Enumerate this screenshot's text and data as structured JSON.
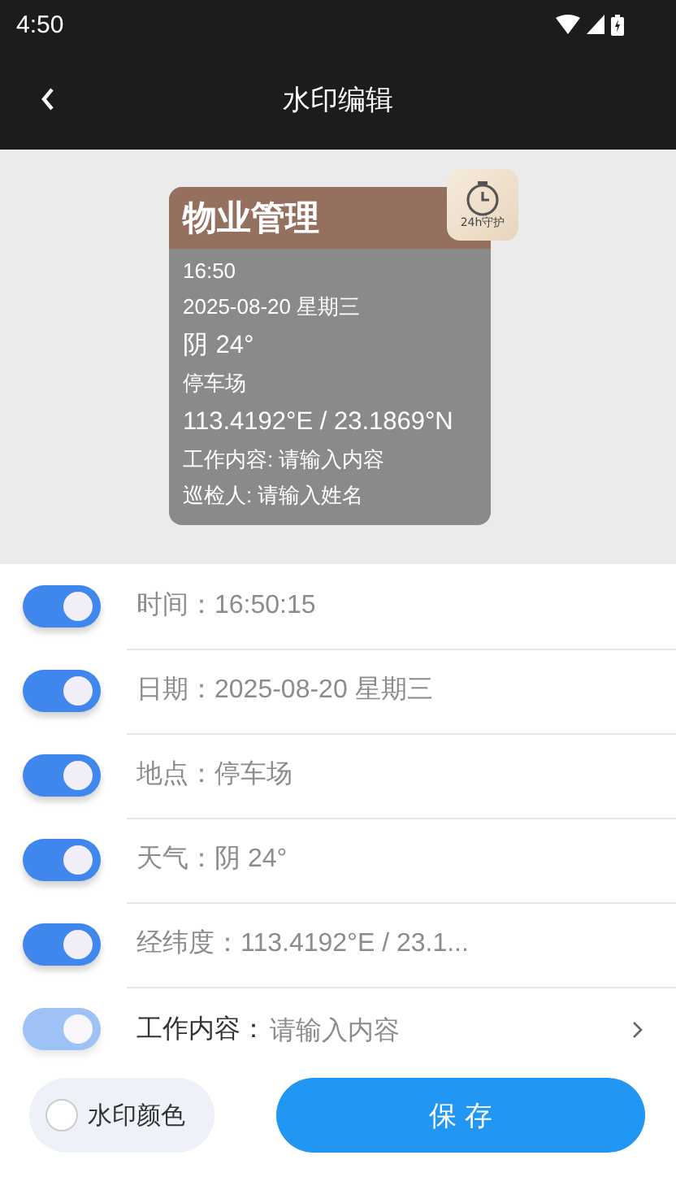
{
  "status_bar": {
    "time": "4:50"
  },
  "header": {
    "title": "水印编辑"
  },
  "preview": {
    "title": "物业管理",
    "badge": "24h守护",
    "lines": [
      {
        "text": "16:50",
        "kind": "small"
      },
      {
        "text": "2025-08-20 星期三",
        "kind": "small"
      },
      {
        "text": "阴 24°",
        "kind": "large"
      },
      {
        "text": "停车场",
        "kind": "small"
      },
      {
        "text": "113.4192°E / 23.1869°N",
        "kind": "large"
      },
      {
        "text": "工作内容: 请输入内容",
        "kind": "small"
      },
      {
        "text": "巡检人: 请输入姓名",
        "kind": "small"
      }
    ]
  },
  "settings": [
    {
      "kind": "toggle",
      "label": "时间：",
      "value": "16:50:15",
      "on": true,
      "disabled": false
    },
    {
      "kind": "toggle",
      "label": "日期：",
      "value": "2025-08-20 星期三",
      "on": true,
      "disabled": false
    },
    {
      "kind": "toggle",
      "label": "地点：",
      "value": "停车场",
      "on": true,
      "disabled": false
    },
    {
      "kind": "toggle",
      "label": "天气：",
      "value": "阴 24°",
      "on": true,
      "disabled": false
    },
    {
      "kind": "toggle",
      "label": "经纬度：",
      "value": "113.4192°E / 23.1...",
      "on": true,
      "disabled": false
    },
    {
      "kind": "input",
      "label": "工作内容：",
      "placeholder": "请输入内容",
      "on": true,
      "disabled": true
    }
  ],
  "footer": {
    "color_option": {
      "label": "水印颜色",
      "checked": false
    },
    "save": "保 存"
  }
}
